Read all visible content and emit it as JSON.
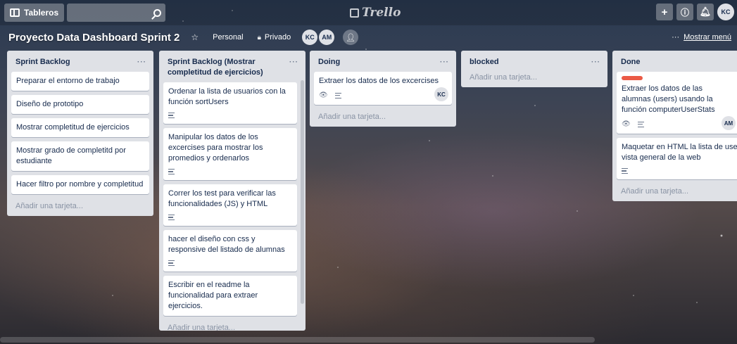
{
  "topbar": {
    "boards_label": "Tableros",
    "logo": "Trello",
    "avatar_initials": "KC",
    "icons": [
      "plus-icon",
      "info-icon",
      "bell-icon"
    ]
  },
  "board": {
    "title": "Proyecto Data Dashboard Sprint 2",
    "visibility_team": "Personal",
    "visibility": "Privado",
    "members": [
      "KC",
      "AM"
    ],
    "show_menu": "Mostrar menú"
  },
  "add_card_label": "Añadir una tarjeta...",
  "lists": [
    {
      "title": "Sprint Backlog",
      "cards": [
        {
          "text": "Preparar el entorno de trabajo"
        },
        {
          "text": "Diseño de prototipo"
        },
        {
          "text": "Mostrar completitud de ejercicios"
        },
        {
          "text": "Mostrar grado de completitd por estudiante"
        },
        {
          "text": "Hacer filtro por nombre y completitud"
        }
      ]
    },
    {
      "title": "Sprint Backlog (Mostrar completitud de ejercicios)",
      "cards": [
        {
          "text": "Ordenar la lista de usuarios con la función sortUsers"
        },
        {
          "text": "Manipular los datos de los excercises para mostrar los promedios y ordenarlos"
        },
        {
          "text": "Correr los test para verificar las funcionalidades (JS) y HTML"
        },
        {
          "text": "hacer el diseño con css y responsive del listado de alumnas"
        },
        {
          "text": "Escribir en el readme la funcionalidad para extraer ejercicios."
        }
      ]
    },
    {
      "title": "Doing",
      "cards": [
        {
          "text": "Extraer los datos de los excercises",
          "member": "KC"
        }
      ]
    },
    {
      "title": "blocked",
      "cards": []
    },
    {
      "title": "Done",
      "cards": [
        {
          "text": "Extraer los datos de las alumnas (users) usando la función computerUserStats",
          "member": "AM",
          "label_color": "#eb5a46"
        },
        {
          "text": "Maquetar en HTML la lista de users una vista general de la web"
        }
      ]
    }
  ]
}
